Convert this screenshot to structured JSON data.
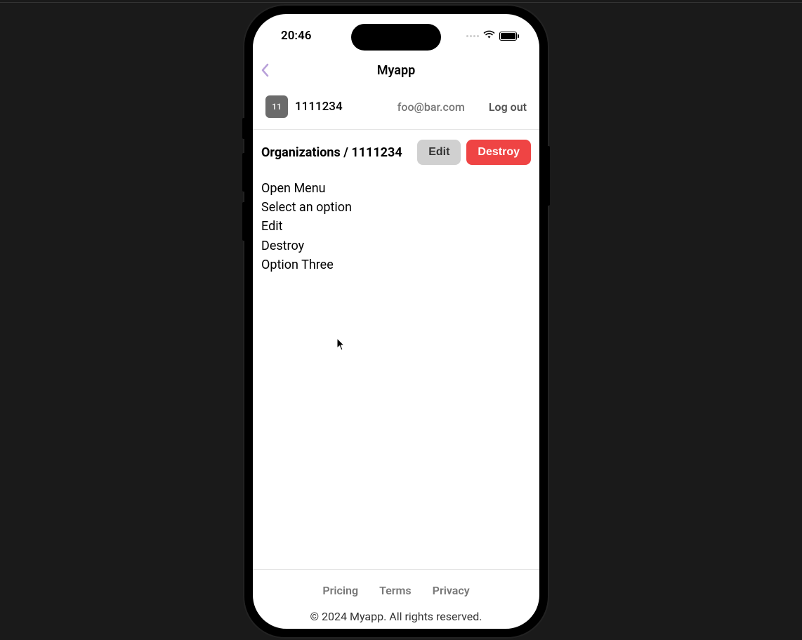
{
  "statusBar": {
    "time": "20:46"
  },
  "nav": {
    "title": "Myapp"
  },
  "user": {
    "avatar": "11",
    "name": "1111234",
    "email": "foo@bar.com",
    "logout": "Log out"
  },
  "page": {
    "breadcrumb": "Organizations / 1111234",
    "editLabel": "Edit",
    "destroyLabel": "Destroy"
  },
  "menu": {
    "items": [
      "Open Menu",
      "Select an option",
      "Edit",
      "Destroy",
      "Option Three"
    ]
  },
  "footer": {
    "links": [
      "Pricing",
      "Terms",
      "Privacy"
    ],
    "copyright": "© 2024 Myapp. All rights reserved."
  }
}
